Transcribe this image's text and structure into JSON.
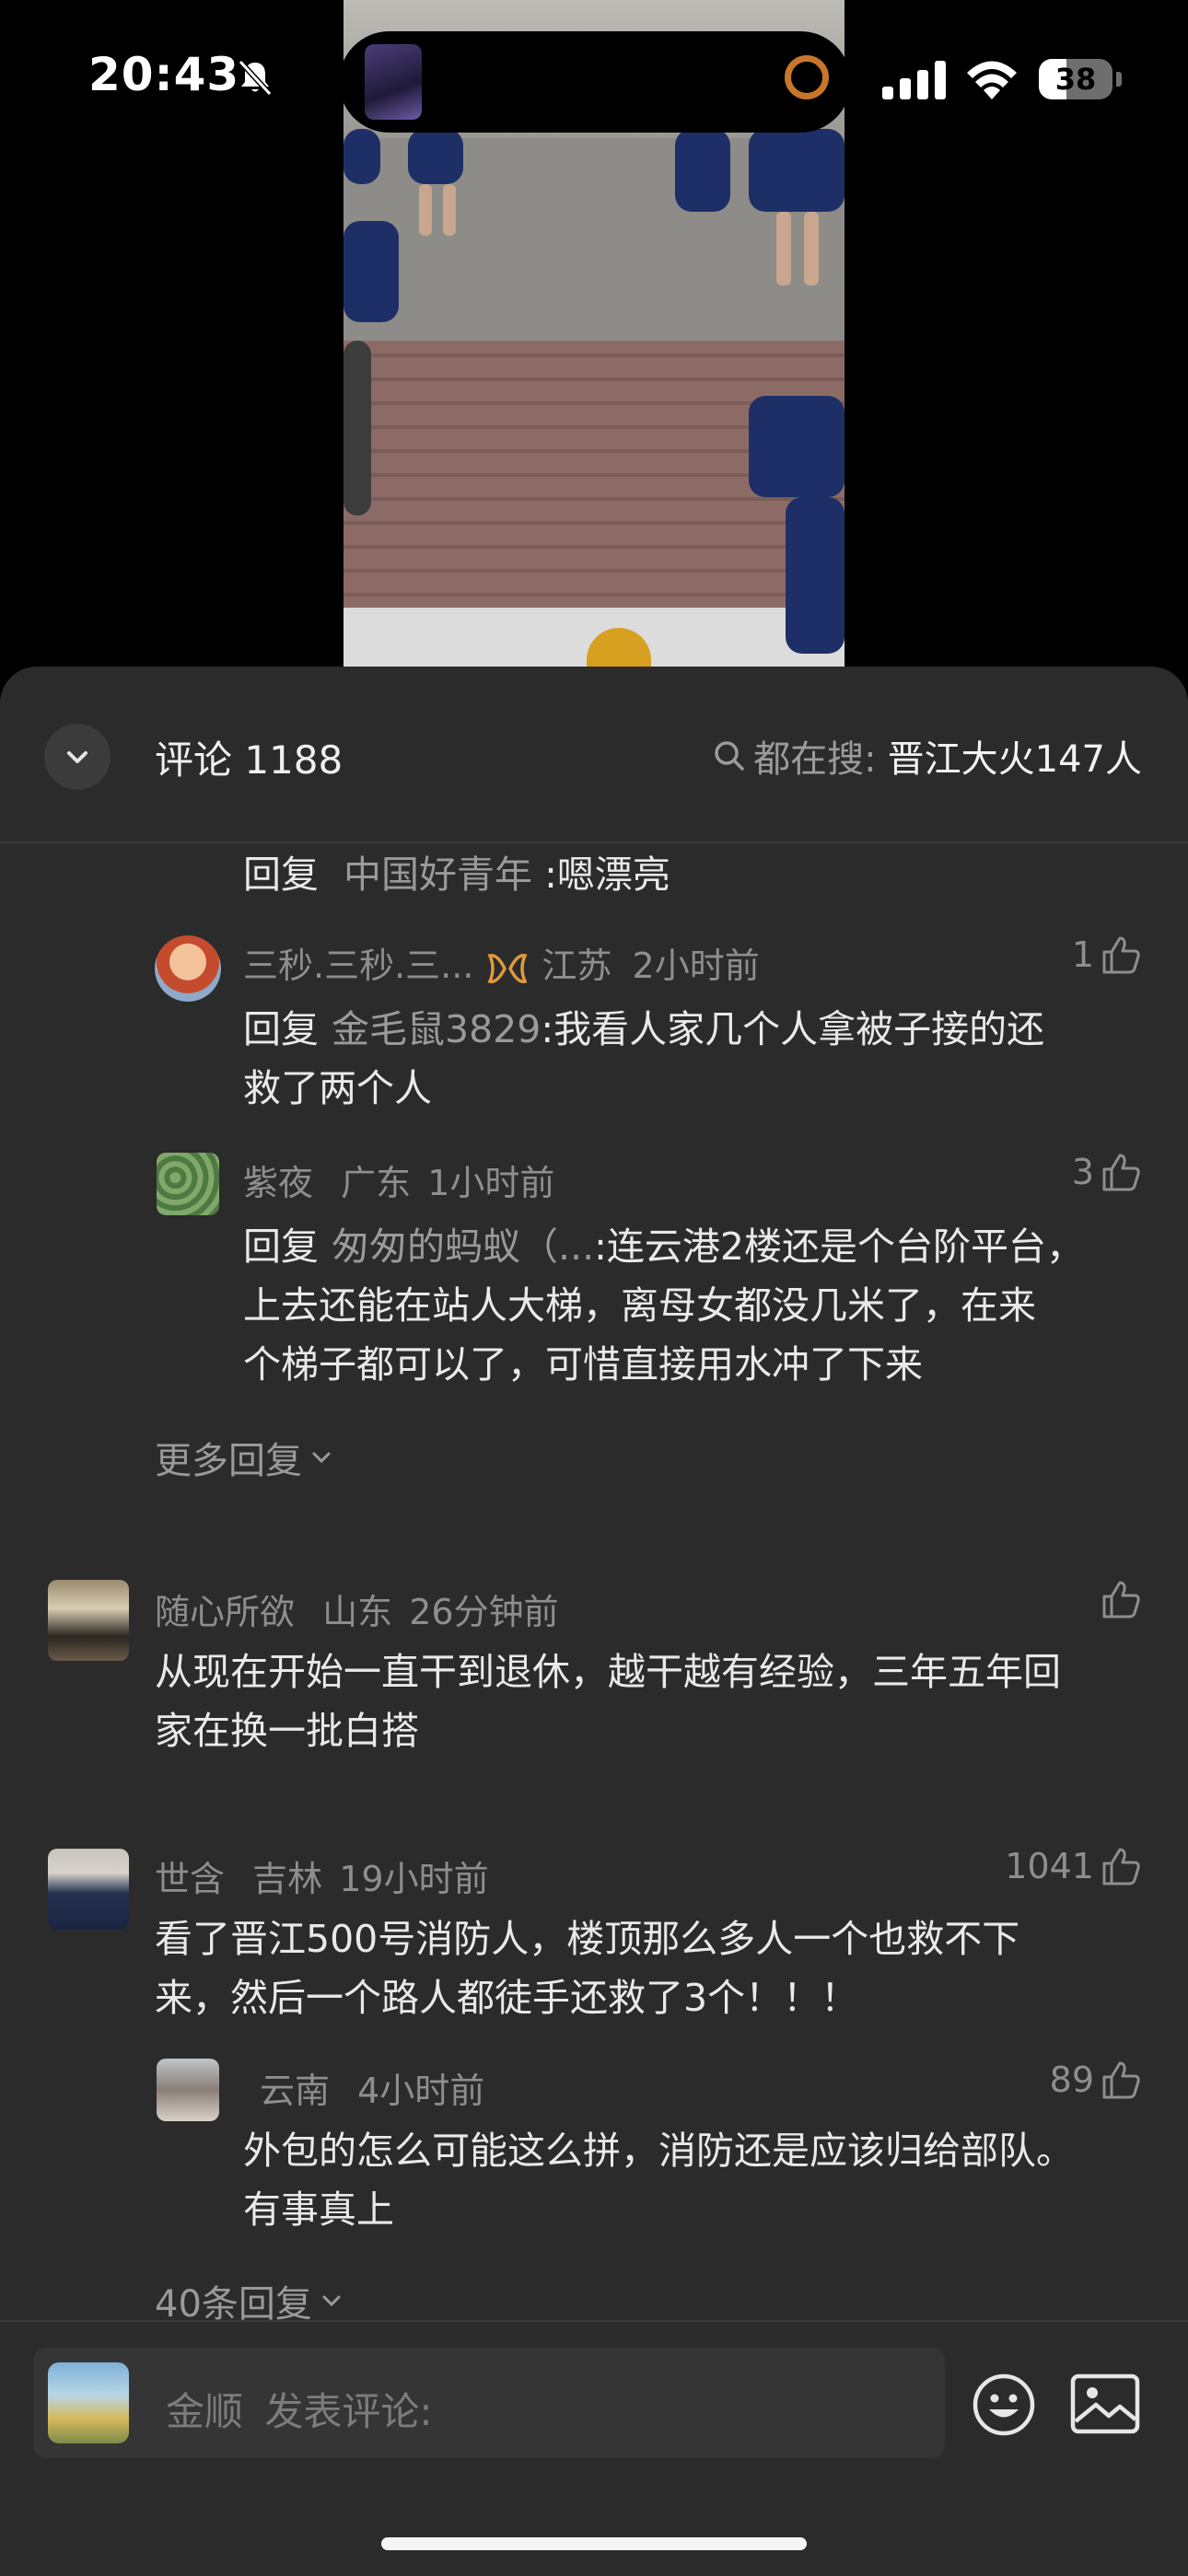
{
  "status_bar": {
    "time": "20:43",
    "battery": "38",
    "battery_level": 0.38
  },
  "comments_header": {
    "title": "评论 1188",
    "search_prefix": "都在搜:",
    "search_term": "晋江大火147人"
  },
  "thread": [
    {
      "kind": "reply_text",
      "reply_word": "回复",
      "reply_to": "中国好青年",
      "text": ":嗯漂亮"
    },
    {
      "kind": "reply",
      "user": "三秒.三秒.三...",
      "location": "江苏",
      "time": "2小时前",
      "likes": "1",
      "reply_word": "回复",
      "reply_to": "金毛鼠3829",
      "text_lines": [
        ":我看人家几个人拿被子接的还",
        "救了两个人"
      ]
    },
    {
      "kind": "reply",
      "user": "紫夜",
      "location": "广东",
      "time": "1小时前",
      "likes": "3",
      "reply_word": "回复",
      "reply_to": "匆匆的蚂蚁（...",
      "text_lines": [
        ":连云港2楼还是个台阶平台，",
        "上去还能在站人大梯，离母女都没几米了，在来",
        "个梯子都可以了，可惜直接用水冲了下来"
      ]
    },
    {
      "kind": "more",
      "label": "更多回复"
    }
  ],
  "comments": [
    {
      "user": "随心所欲",
      "location": "山东",
      "time": "26分钟前",
      "likes": "",
      "text_lines": [
        "从现在开始一直干到退休，越干越有经验，三年五年回",
        "家在换一批白搭"
      ]
    },
    {
      "user": "世含",
      "location": "吉林",
      "time": "19小时前",
      "likes": "1041",
      "text_lines": [
        "看了晋江500号消防人，楼顶那么多人一个也救不下",
        "来，然后一个路人都徒手还救了3个！！！"
      ],
      "reply": {
        "user": "云南",
        "time": "4小时前",
        "likes": "89",
        "text_lines": [
          "外包的怎么可能这么拼，消防还是应该归给部队。",
          "有事真上"
        ]
      },
      "more_label": "40条回复"
    }
  ],
  "input": {
    "user": "金顺",
    "placeholder": "发表评论:"
  },
  "icons": [
    "bell-slash-icon",
    "signal-icon",
    "wifi-icon",
    "battery-icon",
    "chevron-down-icon",
    "search-icon",
    "thumbs-up-icon",
    "badge-icon",
    "emoji-icon",
    "image-icon"
  ],
  "colors": {
    "panel": "#2b2b2b",
    "text": "#e9e9e9",
    "muted": "#8e8e8e",
    "badge": "#e09a3c"
  }
}
